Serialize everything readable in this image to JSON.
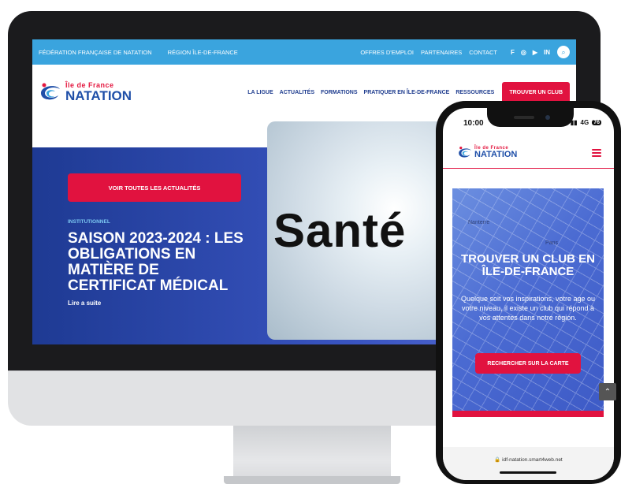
{
  "desktop": {
    "topbar": {
      "left": [
        "FÉDÉRATION FRANÇAISE DE NATATION",
        "RÉGION ÎLE-DE-FRANCE"
      ],
      "right": [
        "OFFRES D'EMPLOI",
        "PARTENAIRES",
        "CONTACT"
      ],
      "social_icons": [
        "facebook-icon",
        "instagram-icon",
        "youtube-icon",
        "linkedin-icon",
        "search-icon"
      ]
    },
    "logo": {
      "top": "Île de France",
      "bottom": "NATATION"
    },
    "nav": {
      "items": [
        "LA LIGUE",
        "ACTUALITÉS",
        "FORMATIONS",
        "PRATIQUER EN ÎLE-DE-FRANCE",
        "RESSOURCES"
      ],
      "cta": "TROUVER UN CLUB"
    },
    "hero": {
      "button": "VOIR TOUTES LES ACTUALITÉS",
      "category": "INSTITUTIONNEL",
      "headline": "SAISON 2023-2024 : LES OBLIGATIONS EN MATIÈRE DE CERTIFICAT MÉDICAL",
      "read_more": "Lire a suite",
      "image_text": "Santé"
    }
  },
  "phone": {
    "time": "10:00",
    "network": "4G",
    "battery": "76",
    "logo": {
      "top": "Île de France",
      "bottom": "NATATION"
    },
    "map_labels": [
      "Nanterre",
      "Paris"
    ],
    "title": "TROUVER UN CLUB EN ÎLE-DE-FRANCE",
    "description": "Quelque soit vos inspirations, votre age ou votre niveau, il existe un club qui répond à vos attentes dans notre région.",
    "button": "RECHERCHER SUR LA CARTE",
    "url": "idf-natation.smart4web.net"
  },
  "colors": {
    "accent_red": "#e1123f",
    "topbar_blue": "#3aa4de",
    "navy": "#1f3d8f"
  }
}
